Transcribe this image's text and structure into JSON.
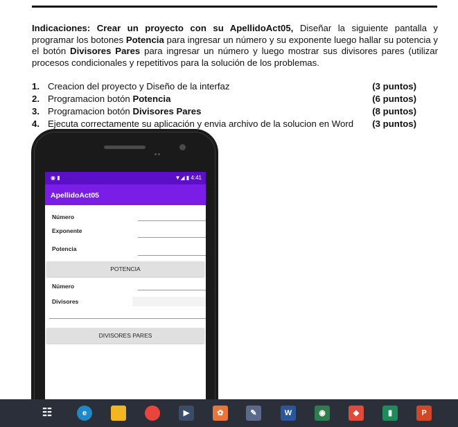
{
  "document": {
    "intro_parts": [
      {
        "text": "Indicaciones: Crear un proyecto con su ApellidoAct05,",
        "bold": true
      },
      {
        "text": " Diseñar la siguiente pantalla y programar los botones ",
        "bold": false
      },
      {
        "text": "Potencia",
        "bold": true
      },
      {
        "text": " para ingresar un número y su exponente luego hallar su potencia y el botón ",
        "bold": false
      },
      {
        "text": "Divisores Pares",
        "bold": true
      },
      {
        "text": " para ingresar un número y luego mostrar sus divisores pares (utilizar procesos condicionales y repetitivos para la solución de los problemas.",
        "bold": false
      }
    ],
    "tasks": [
      {
        "num": "1.",
        "text": "Creacion del proyecto y Diseño de la interfaz",
        "bold": "",
        "points": "(3 puntos)"
      },
      {
        "num": "2.",
        "text": "Programacion botón ",
        "bold": "Potencia",
        "points": "(6 puntos)"
      },
      {
        "num": "3.",
        "text": "Programacion botón ",
        "bold": "Divisores Pares",
        "points": "(8 puntos)"
      },
      {
        "num": "4.",
        "text": "Ejecuta correctamente su aplicación y envia archivo de la solucion en Word",
        "bold": "",
        "points": "(3 puntos)"
      }
    ]
  },
  "phone": {
    "status_time": "4:41",
    "status_left": "◉ ▮",
    "status_right_icons": "▼◢ ▮",
    "app_title": "ApellidoAct05",
    "labels": {
      "numero1": "Número",
      "exponente": "Exponente",
      "potencia": "Potencia",
      "numero2": "Número",
      "divisores": "Divisores"
    },
    "buttons": {
      "potencia": "POTENCIA",
      "divisores_pares": "DIVISORES PARES"
    },
    "colors": {
      "statusbar": "#5b0fc7",
      "appbar": "#7a1de6"
    }
  },
  "taskbar": {
    "items": [
      {
        "name": "task-view-icon",
        "glyph": "☷",
        "color": "#2b2f3a"
      },
      {
        "name": "edge-icon",
        "glyph": "e",
        "color": "#1e88c8"
      },
      {
        "name": "file-explorer-icon",
        "glyph": "",
        "color": "#f2b622"
      },
      {
        "name": "chrome-icon",
        "glyph": "",
        "color": "#e8453c"
      },
      {
        "name": "media-player-icon",
        "glyph": "▶",
        "color": "#3b4c6b"
      },
      {
        "name": "app-orange-icon",
        "glyph": "✿",
        "color": "#e8753a"
      },
      {
        "name": "app-pen-icon",
        "glyph": "✎",
        "color": "#5a6a8a"
      },
      {
        "name": "word-icon",
        "glyph": "W",
        "color": "#2b579a"
      },
      {
        "name": "android-studio-icon",
        "glyph": "◉",
        "color": "#2f7d4f"
      },
      {
        "name": "app-red-icon",
        "glyph": "◆",
        "color": "#e04a3a"
      },
      {
        "name": "app-green-icon",
        "glyph": "▮",
        "color": "#1f8a5a"
      },
      {
        "name": "powerpoint-icon",
        "glyph": "P",
        "color": "#d24726"
      }
    ]
  }
}
